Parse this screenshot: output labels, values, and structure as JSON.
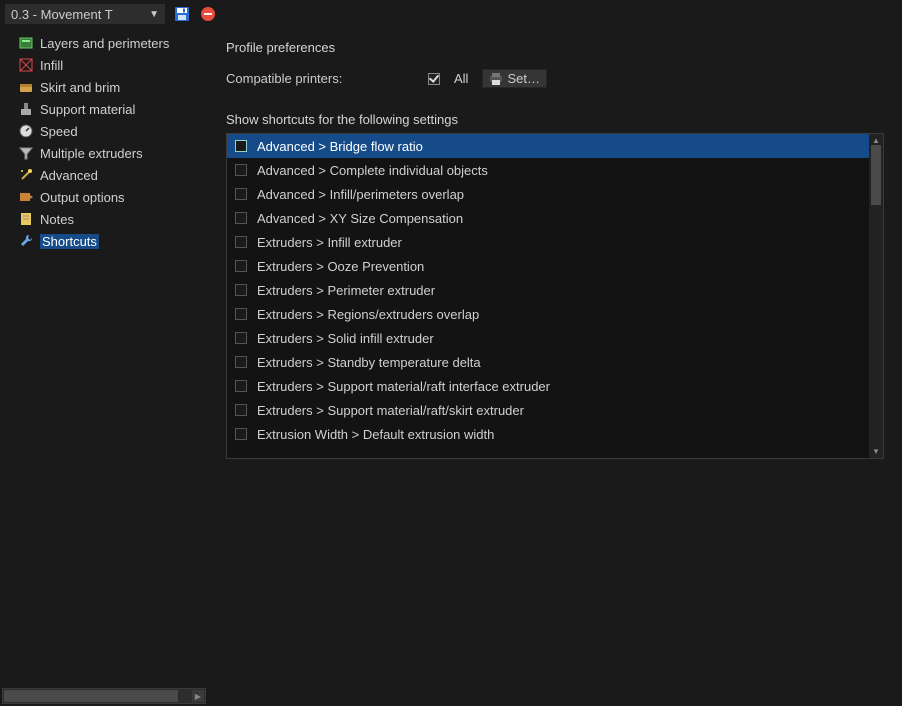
{
  "toolbar": {
    "profile_name": "0.3 - Movement T"
  },
  "sidebar": {
    "items": [
      {
        "label": "Layers and perimeters",
        "icon": "layers"
      },
      {
        "label": "Infill",
        "icon": "infill"
      },
      {
        "label": "Skirt and brim",
        "icon": "skirt"
      },
      {
        "label": "Support material",
        "icon": "support"
      },
      {
        "label": "Speed",
        "icon": "speed"
      },
      {
        "label": "Multiple extruders",
        "icon": "funnel"
      },
      {
        "label": "Advanced",
        "icon": "wand"
      },
      {
        "label": "Output options",
        "icon": "output"
      },
      {
        "label": "Notes",
        "icon": "notes"
      },
      {
        "label": "Shortcuts",
        "icon": "wrench",
        "selected": true
      }
    ]
  },
  "prefs": {
    "section_title": "Profile preferences",
    "compat_label": "Compatible printers:",
    "all_label": "All",
    "all_checked": true,
    "set_btn": "Set…"
  },
  "shortcuts": {
    "title": "Show shortcuts for the following settings",
    "items": [
      {
        "label": "Advanced > Bridge flow ratio",
        "selected": true
      },
      {
        "label": "Advanced > Complete individual objects"
      },
      {
        "label": "Advanced > Infill/perimeters overlap"
      },
      {
        "label": "Advanced > XY Size Compensation"
      },
      {
        "label": "Extruders > Infill extruder"
      },
      {
        "label": "Extruders > Ooze Prevention"
      },
      {
        "label": "Extruders > Perimeter extruder"
      },
      {
        "label": "Extruders > Regions/extruders overlap"
      },
      {
        "label": "Extruders > Solid infill extruder"
      },
      {
        "label": "Extruders > Standby temperature delta"
      },
      {
        "label": "Extruders > Support material/raft interface extruder"
      },
      {
        "label": "Extruders > Support material/raft/skirt extruder"
      },
      {
        "label": "Extrusion Width > Default extrusion width"
      }
    ]
  }
}
